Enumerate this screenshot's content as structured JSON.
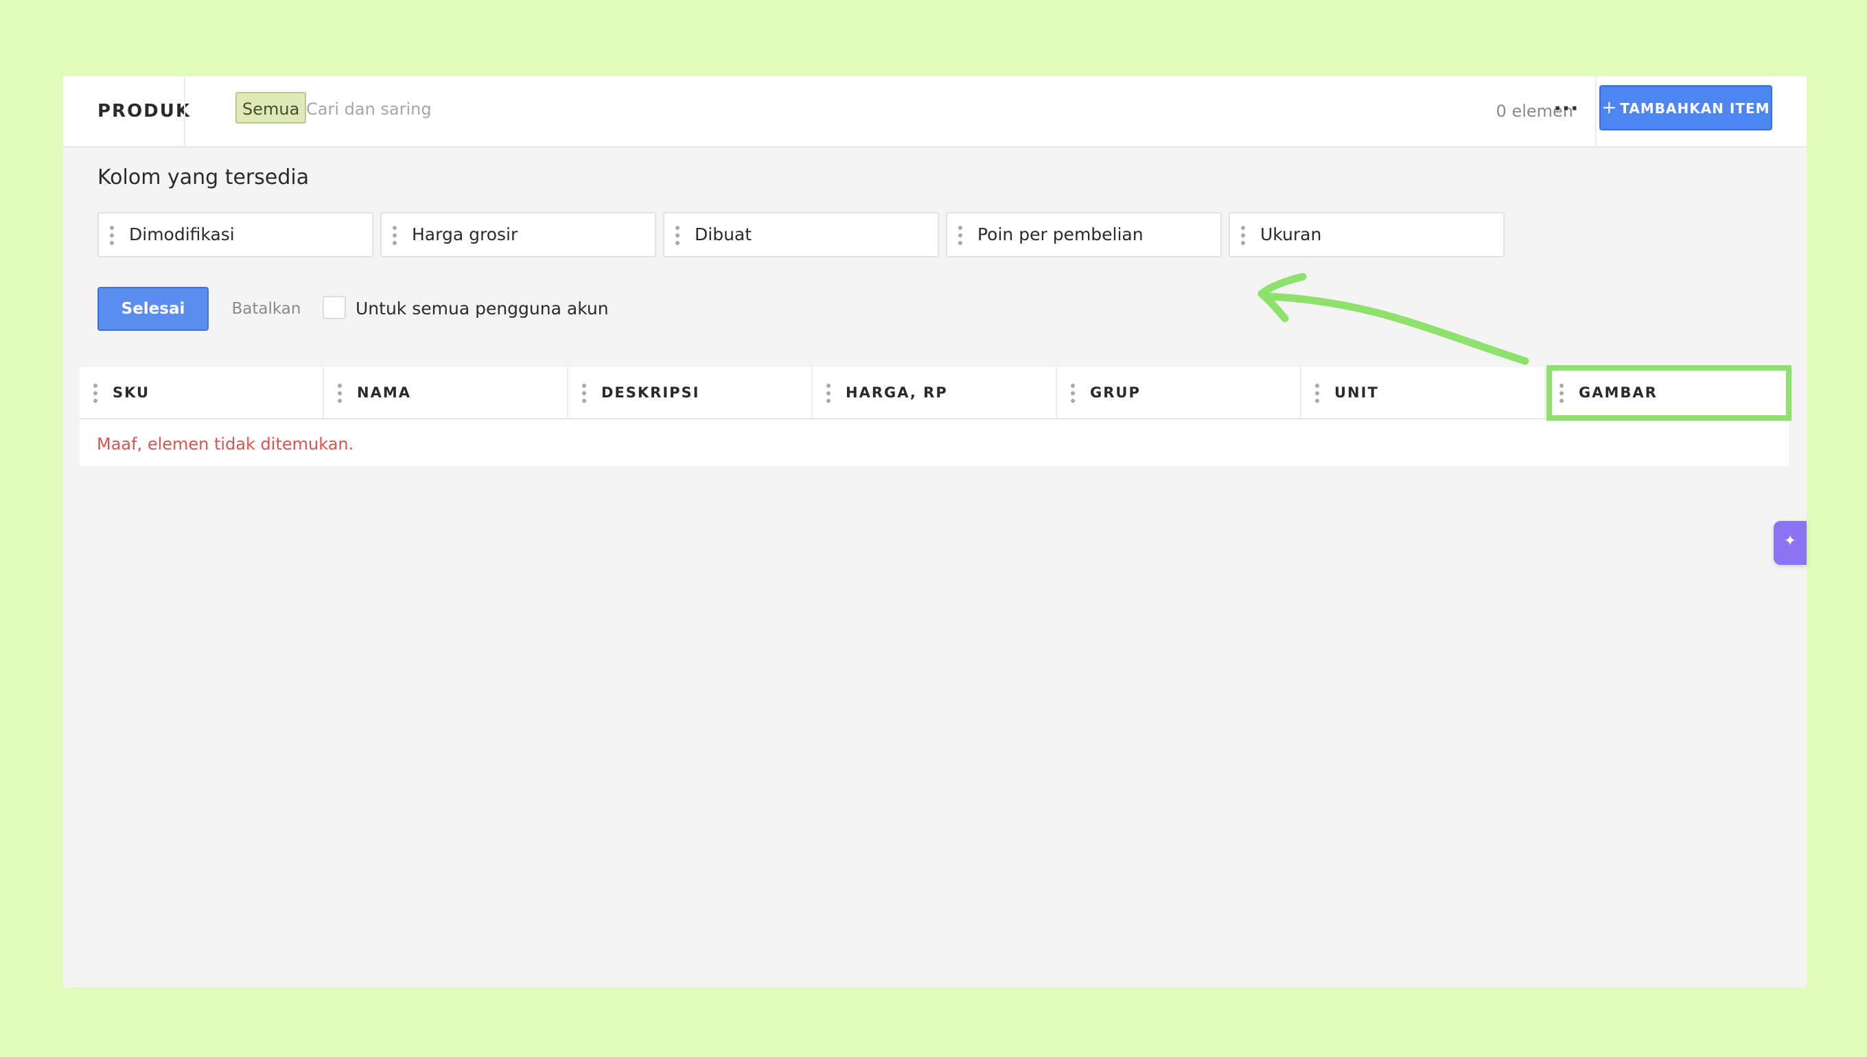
{
  "header": {
    "title": "PRODUK",
    "filter_chip": "Semua",
    "search_placeholder": "Cari dan saring",
    "count": "0 elemen",
    "more": "···",
    "add_button": "TAMBAHKAN ITEM",
    "add_plus": "+"
  },
  "available": {
    "title": "Kolom yang tersedia",
    "columns": [
      "Dimodifikasi",
      "Harga grosir",
      "Dibuat",
      "Poin per pembelian",
      "Ukuran"
    ]
  },
  "actions": {
    "done": "Selesai",
    "cancel": "Batalkan",
    "all_users_label": "Untuk semua pengguna akun"
  },
  "table": {
    "columns": [
      "SKU",
      "NAMA",
      "DESKRIPSI",
      "HARGA, RP",
      "GRUP",
      "UNIT",
      "GAMBAR"
    ],
    "empty_message": "Maaf, elemen tidak ditemukan."
  },
  "colors": {
    "background": "#e0fbbc",
    "accent": "#4d86f0",
    "highlight": "#8ee26b",
    "error": "#d9534f",
    "assist": "#8b73f2"
  },
  "icons": {
    "more": "more-horizontal-icon",
    "add": "plus-icon",
    "grip": "drag-handle-icon",
    "assist": "sparkle-icon"
  }
}
